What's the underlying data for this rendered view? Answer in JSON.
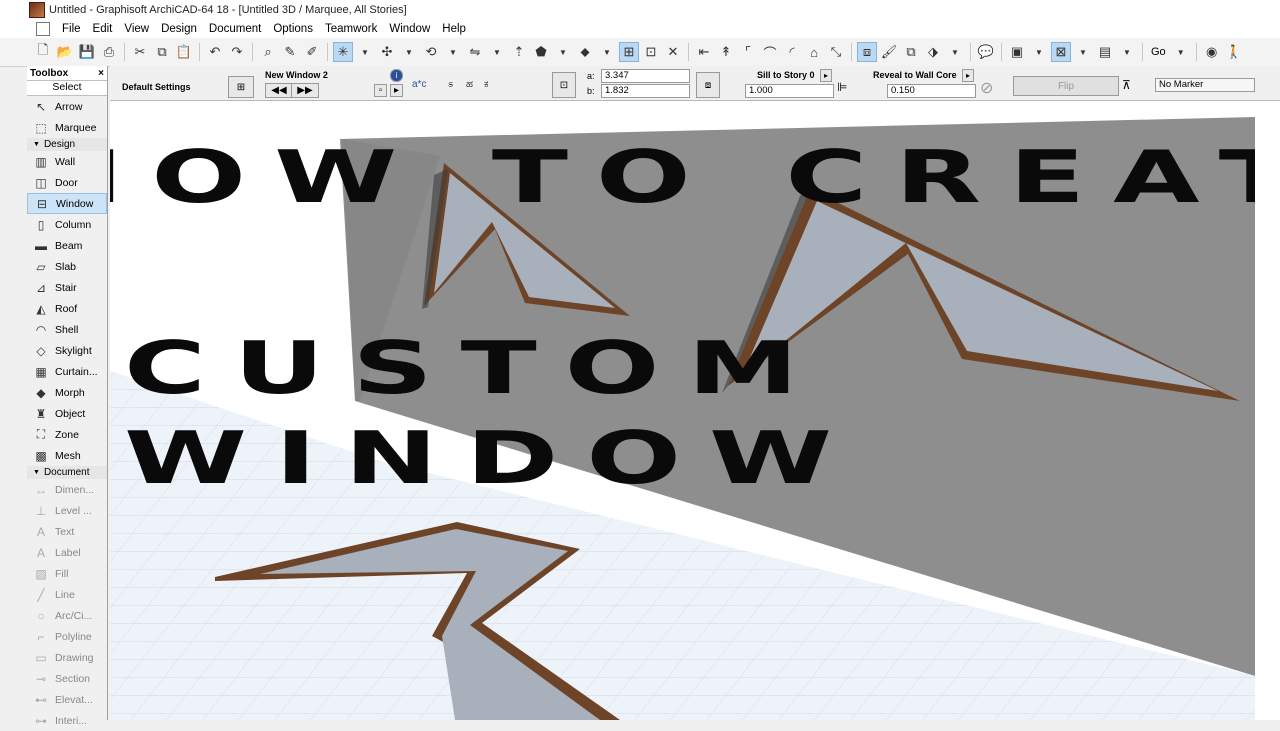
{
  "window": {
    "title": "Untitled - Graphisoft ArchiCAD-64 18 - [Untitled 3D / Marquee, All Stories]"
  },
  "menu": [
    "File",
    "Edit",
    "View",
    "Design",
    "Document",
    "Options",
    "Teamwork",
    "Window",
    "Help"
  ],
  "toolbar": {
    "go_label": "Go"
  },
  "toolbox": {
    "title": "Toolbox",
    "close": "×",
    "select_label": "Select",
    "top_tools": [
      {
        "label": "Arrow",
        "icon": "arrow-icon",
        "glyph": "↖"
      },
      {
        "label": "Marquee",
        "icon": "marquee-icon",
        "glyph": "⬚"
      }
    ],
    "design_group": "Design",
    "design_tools": [
      {
        "label": "Wall",
        "icon": "wall-icon",
        "glyph": "▥"
      },
      {
        "label": "Door",
        "icon": "door-icon",
        "glyph": "◫"
      },
      {
        "label": "Window",
        "icon": "window-icon",
        "glyph": "⊟",
        "selected": true
      },
      {
        "label": "Column",
        "icon": "column-icon",
        "glyph": "▯"
      },
      {
        "label": "Beam",
        "icon": "beam-icon",
        "glyph": "▬"
      },
      {
        "label": "Slab",
        "icon": "slab-icon",
        "glyph": "▱"
      },
      {
        "label": "Stair",
        "icon": "stair-icon",
        "glyph": "⊿"
      },
      {
        "label": "Roof",
        "icon": "roof-icon",
        "glyph": "◭"
      },
      {
        "label": "Shell",
        "icon": "shell-icon",
        "glyph": "◠"
      },
      {
        "label": "Skylight",
        "icon": "skylight-icon",
        "glyph": "◇"
      },
      {
        "label": "Curtain...",
        "icon": "curtain-wall-icon",
        "glyph": "▦"
      },
      {
        "label": "Morph",
        "icon": "morph-icon",
        "glyph": "◆"
      },
      {
        "label": "Object",
        "icon": "object-icon",
        "glyph": "♜"
      },
      {
        "label": "Zone",
        "icon": "zone-icon",
        "glyph": "⛶"
      },
      {
        "label": "Mesh",
        "icon": "mesh-icon",
        "glyph": "▩"
      }
    ],
    "document_group": "Document",
    "document_tools": [
      {
        "label": "Dimen...",
        "icon": "dimension-icon",
        "glyph": "↔"
      },
      {
        "label": "Level ...",
        "icon": "level-dimension-icon",
        "glyph": "⊥"
      },
      {
        "label": "Text",
        "icon": "text-icon",
        "glyph": "A"
      },
      {
        "label": "Label",
        "icon": "label-icon",
        "glyph": "A"
      },
      {
        "label": "Fill",
        "icon": "fill-icon",
        "glyph": "▨"
      },
      {
        "label": "Line",
        "icon": "line-icon",
        "glyph": "╱"
      },
      {
        "label": "Arc/Ci...",
        "icon": "arc-icon",
        "glyph": "○"
      },
      {
        "label": "Polyline",
        "icon": "polyline-icon",
        "glyph": "⌐"
      },
      {
        "label": "Drawing",
        "icon": "drawing-icon",
        "glyph": "▭"
      },
      {
        "label": "Section",
        "icon": "section-icon",
        "glyph": "⊸"
      },
      {
        "label": "Elevat...",
        "icon": "elevation-icon",
        "glyph": "⊷"
      },
      {
        "label": "Interi...",
        "icon": "interior-elevation-icon",
        "glyph": "⊶"
      }
    ]
  },
  "infobox": {
    "default_settings": "Default Settings",
    "window_name": "New Window 2",
    "dim_a_label": "a:",
    "dim_a_value": "3.347",
    "dim_b_label": "b:",
    "dim_b_value": "1.832",
    "sill_label": "Sill to Story 0",
    "sill_value": "1.000",
    "reveal_label": "Reveal to Wall Core",
    "reveal_value": "0.150",
    "flip_label": "Flip",
    "marker_value": "No Marker"
  },
  "overlay": {
    "line1": "HOW  TO CREATE",
    "line2": "CUSTOM",
    "line3": "WINDOW"
  },
  "colors": {
    "wall": "#8a8a8a",
    "glass": "#a6aeb8",
    "frame": "#6e4428",
    "grid": "#cfdcec",
    "floor": "#eef3fa",
    "selection": "#cde3f7"
  }
}
